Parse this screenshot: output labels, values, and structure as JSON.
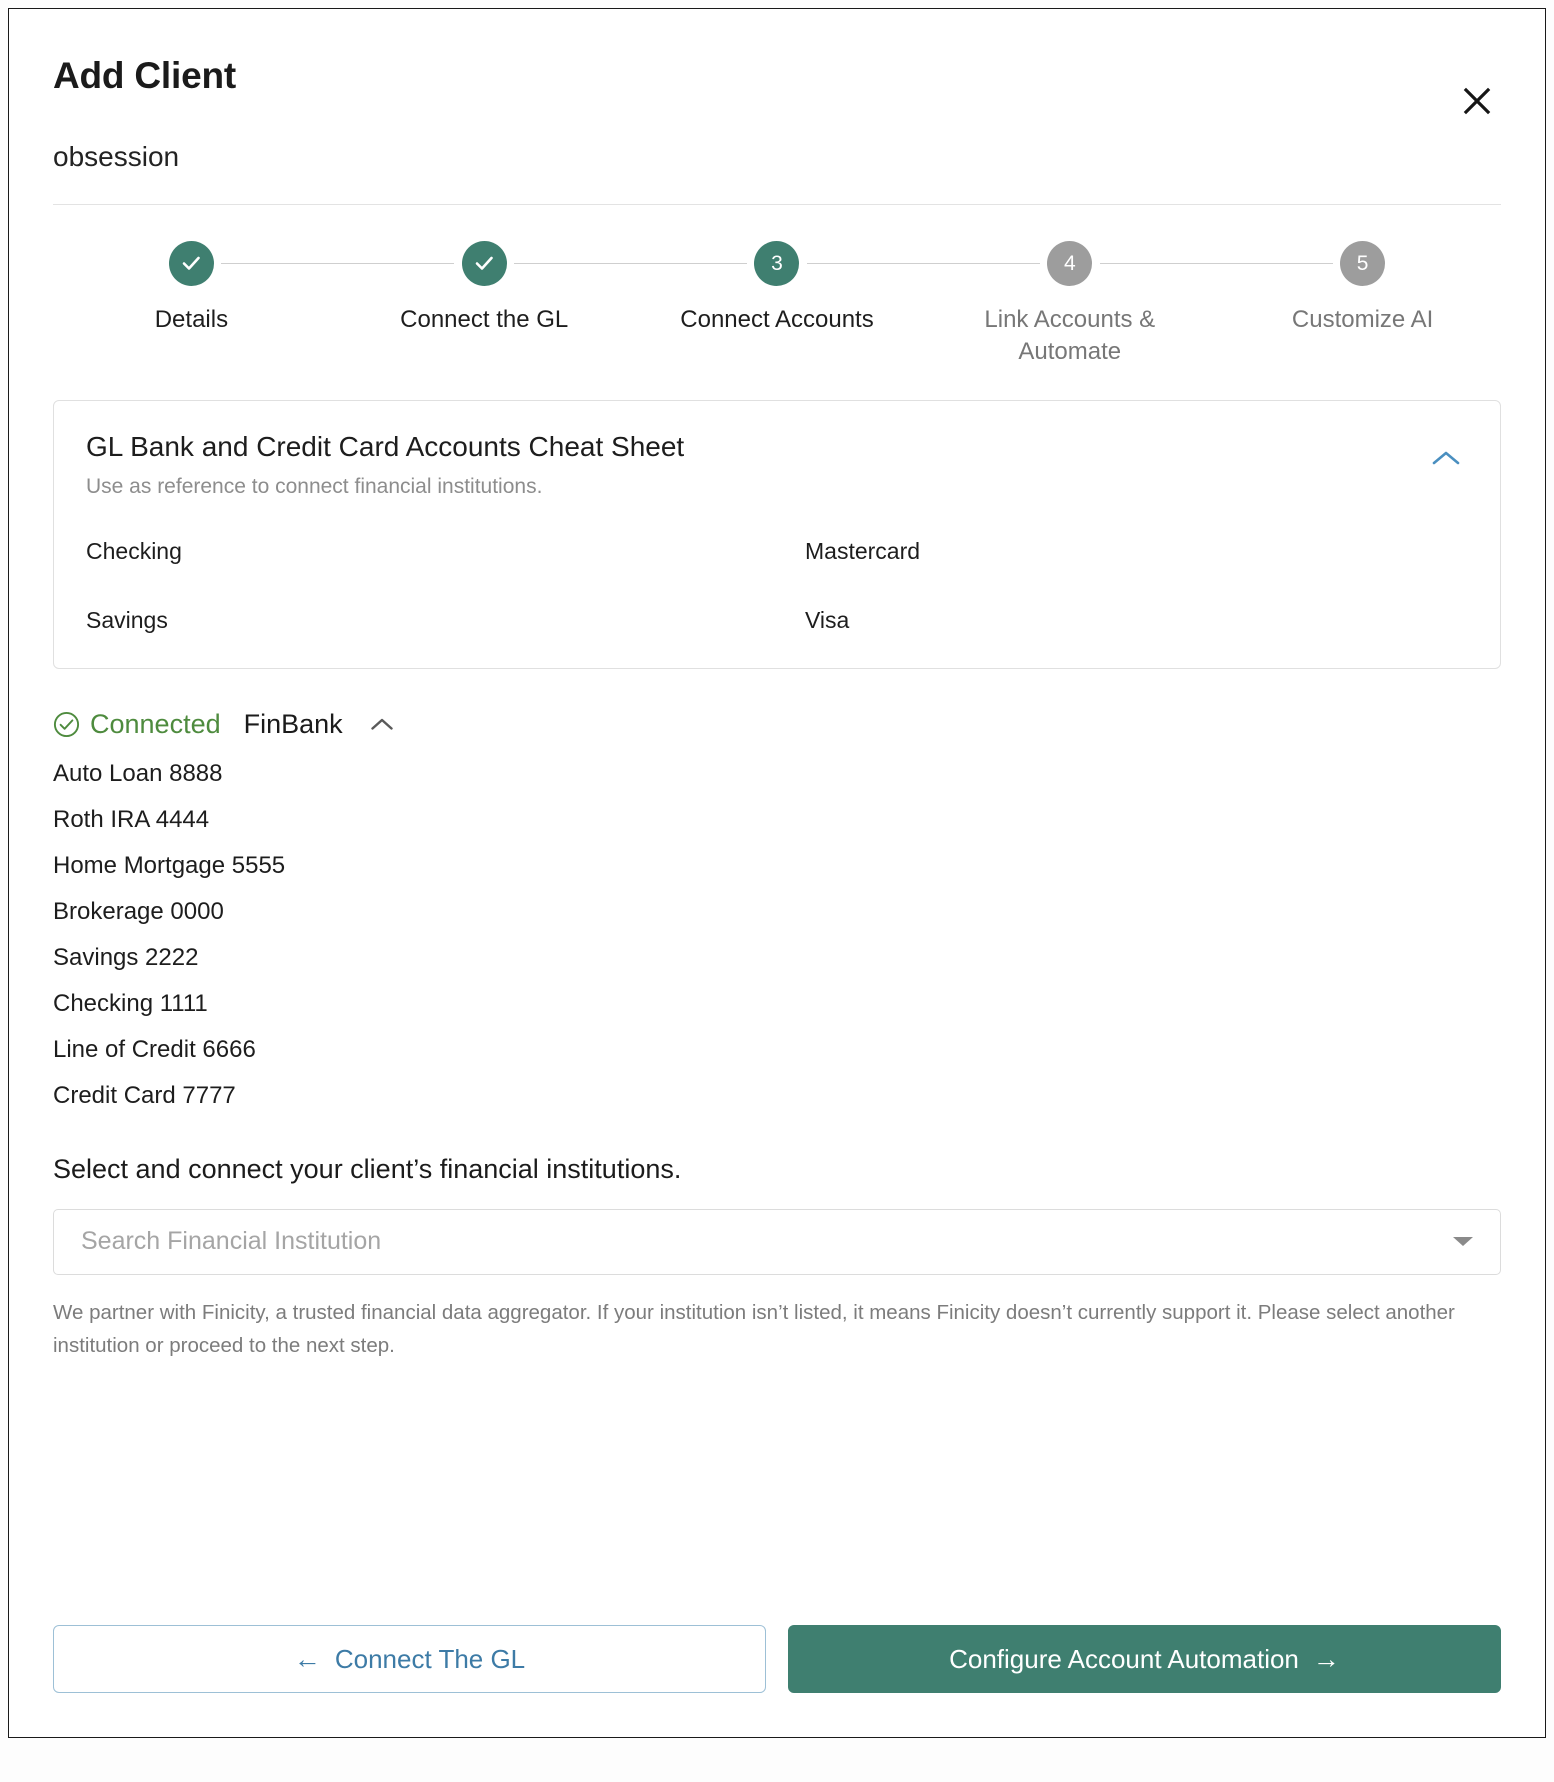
{
  "modal": {
    "title": "Add Client",
    "subtitle": "obsession",
    "close_icon": "close-icon"
  },
  "stepper": {
    "steps": [
      {
        "number": "1",
        "label": "Details",
        "state": "done"
      },
      {
        "number": "2",
        "label": "Connect the GL",
        "state": "done"
      },
      {
        "number": "3",
        "label": "Connect Accounts",
        "state": "active"
      },
      {
        "number": "4",
        "label": "Link Accounts & Automate",
        "state": "todo"
      },
      {
        "number": "5",
        "label": "Customize AI",
        "state": "todo"
      }
    ]
  },
  "cheat_sheet": {
    "title": "GL Bank and Credit Card Accounts Cheat Sheet",
    "subtitle": "Use as reference to connect financial institutions.",
    "toggle_icon": "chevron-up-icon",
    "column_left": [
      "Checking",
      "Savings"
    ],
    "column_right": [
      "Mastercard",
      "Visa"
    ]
  },
  "institution": {
    "status_icon": "check-circle-icon",
    "status": "Connected",
    "name": "FinBank",
    "toggle_icon": "chevron-up-icon",
    "accounts": [
      "Auto Loan 8888",
      "Roth IRA 4444",
      "Home Mortgage 5555",
      "Brokerage 0000",
      "Savings 2222",
      "Checking 1111",
      "Line of Credit 6666",
      "Credit Card 7777"
    ]
  },
  "search": {
    "prompt": "Select and connect your client’s financial institutions.",
    "value": "",
    "placeholder": "Search Financial Institution",
    "caret_icon": "chevron-down-icon",
    "disclaimer": "We partner with Finicity, a trusted financial data aggregator. If your institution isn’t listed, it means Finicity doesn’t currently support it. Please select another institution or proceed to the next step."
  },
  "footer": {
    "back_label": "Connect The GL",
    "back_arrow": "←",
    "next_label": "Configure Account Automation",
    "next_arrow": "→"
  },
  "colors": {
    "accent_green": "#3f7f70",
    "inactive_gray": "#9d9d9d",
    "link_blue": "#3d7ba6",
    "status_green": "#4e8b3e"
  }
}
